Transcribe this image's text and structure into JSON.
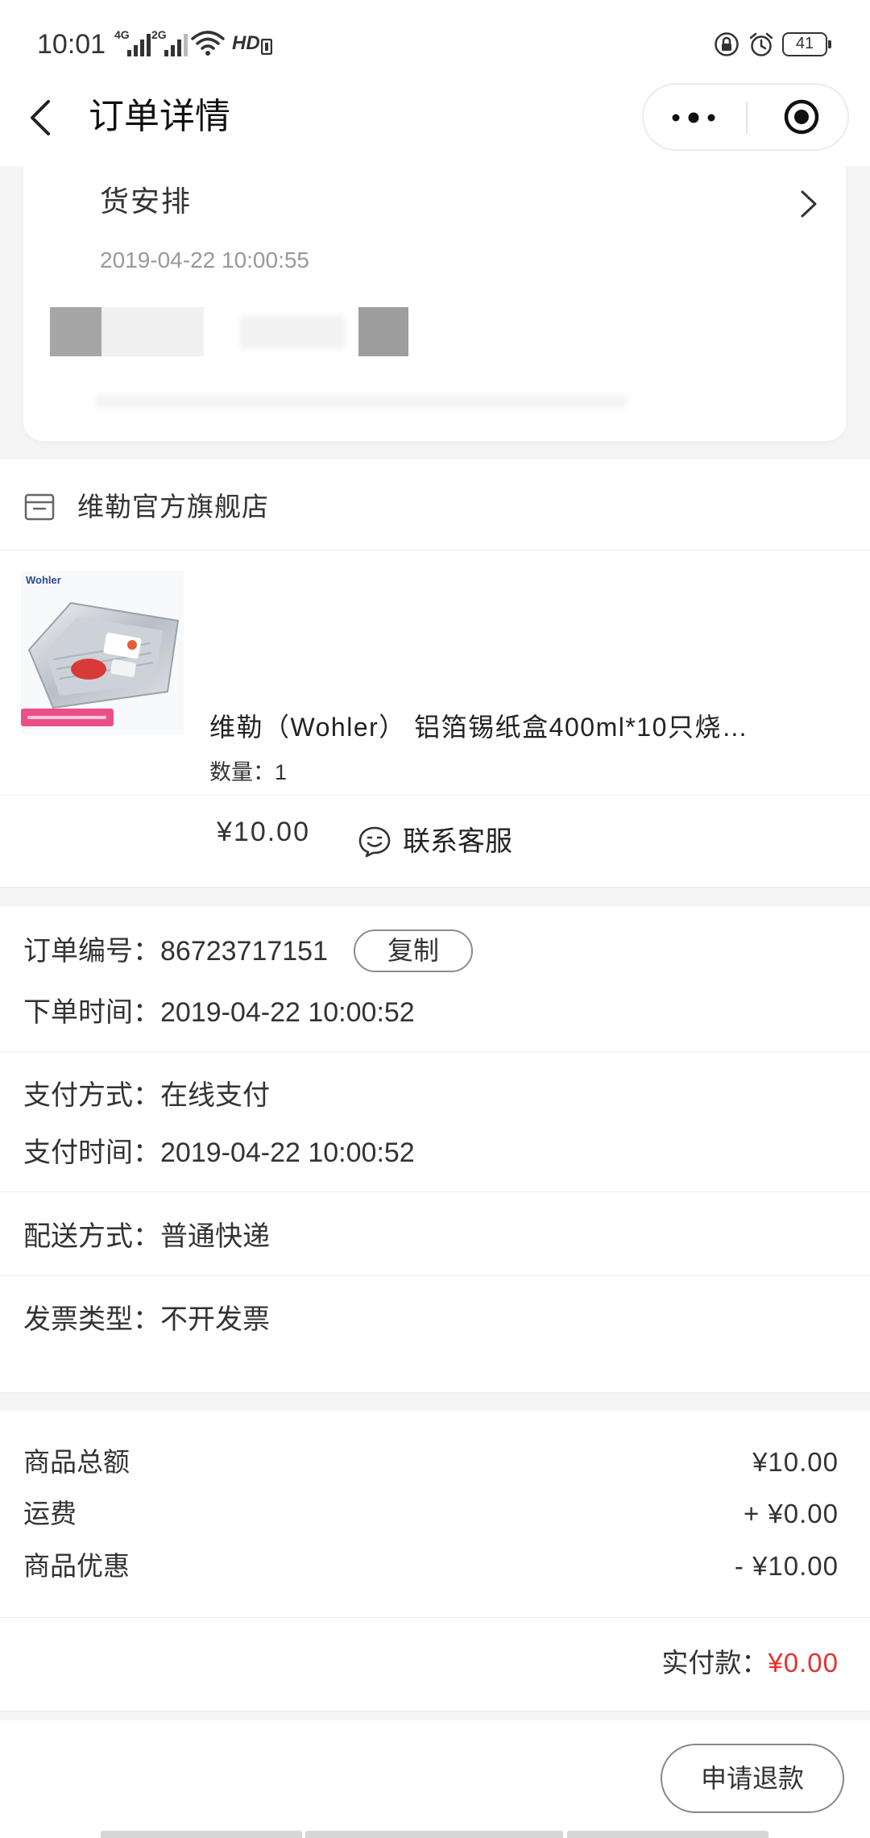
{
  "status_bar": {
    "time": "10:01",
    "network_1": "4G",
    "network_2": "2G",
    "hd_label": "HD",
    "battery_level": "41",
    "icons": [
      "signal-icon",
      "wifi-icon",
      "hd-icon",
      "rotation-lock-icon",
      "alarm-icon",
      "battery-icon"
    ]
  },
  "nav": {
    "title": "订单详情",
    "back_icon": "back-arrow-icon",
    "more_icon": "more-dots-icon",
    "close_icon": "target-circle-icon"
  },
  "logistics": {
    "status": "货安排",
    "time": "2019-04-22 10:00:55",
    "chevron_icon": "chevron-right-icon"
  },
  "store": {
    "icon": "store-icon",
    "name": "维勒官方旗舰店"
  },
  "product": {
    "image_logo": "Wohler",
    "title": "维勒（Wohler） 铝箔锡纸盒400ml*10只烧…",
    "quantity_label": "数量：",
    "quantity": "1",
    "price": "¥10.00"
  },
  "contact": {
    "icon": "customer-service-icon",
    "label": "联系客服"
  },
  "order_info": {
    "order_no": {
      "label": "订单编号：",
      "value": "86723717151"
    },
    "copy_button": "复制",
    "order_time": {
      "label": "下单时间：",
      "value": "2019-04-22 10:00:52"
    },
    "pay_method": {
      "label": "支付方式：",
      "value": "在线支付"
    },
    "pay_time": {
      "label": "支付时间：",
      "value": "2019-04-22 10:00:52"
    },
    "delivery": {
      "label": "配送方式：",
      "value": "普通快递"
    },
    "invoice": {
      "label": "发票类型：",
      "value": "不开发票"
    }
  },
  "summary": {
    "items": [
      {
        "label": "商品总额",
        "value": "¥10.00"
      },
      {
        "label": "运费",
        "value": "+ ¥0.00"
      },
      {
        "label": "商品优惠",
        "value": "- ¥10.00"
      }
    ],
    "total_label": "实付款：",
    "total_value": "¥0.00"
  },
  "footer": {
    "refund_button": "申请退款"
  },
  "colors": {
    "accent_red": "#e5312f",
    "text": "#333333",
    "muted": "#999999",
    "background": "#f5f5f5",
    "tag_pink": "#ec4f86"
  }
}
